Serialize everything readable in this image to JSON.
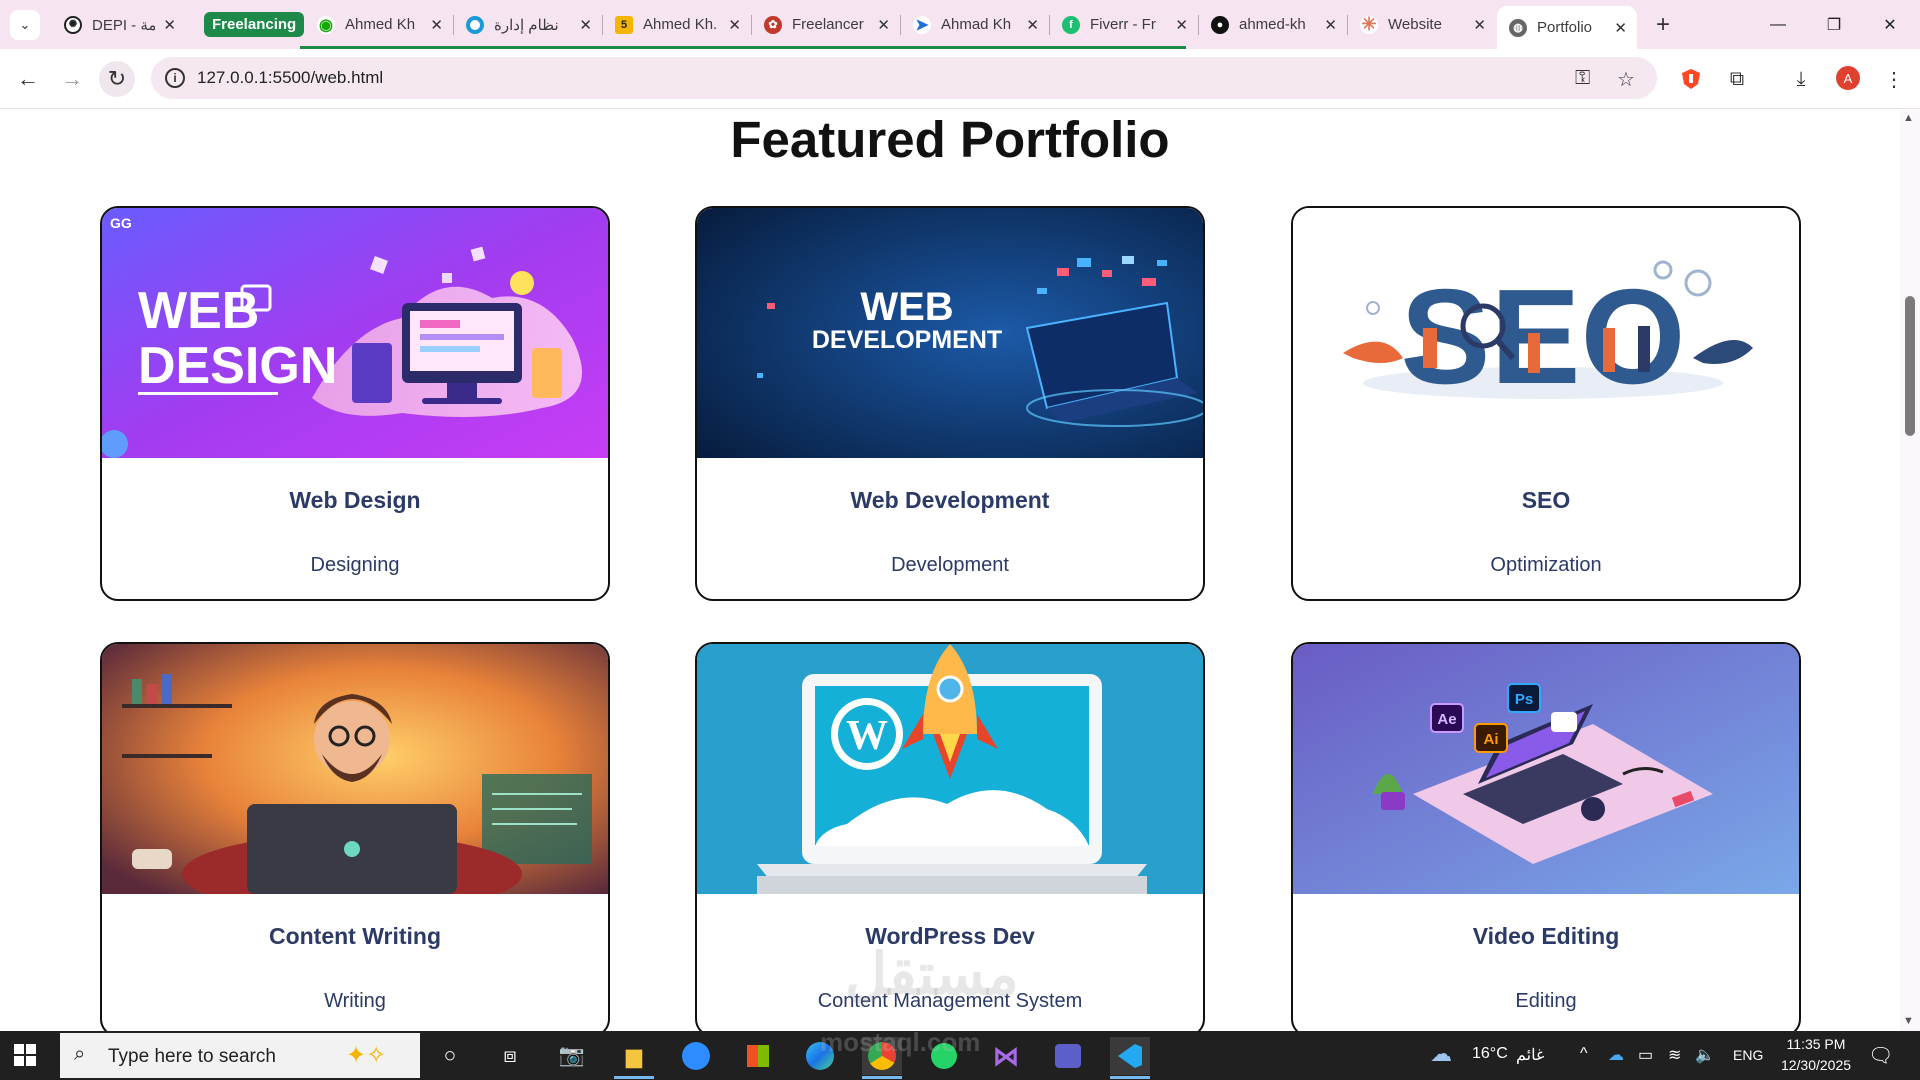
{
  "browser": {
    "tabs": [
      {
        "title": "DEPI - قائمة",
        "favicon": "chatgpt-icon",
        "color": "#202123"
      },
      {
        "title": "Ahmed Kh",
        "favicon": "upwork-icon",
        "color": "#14a800"
      },
      {
        "title": "نظام إدارة",
        "favicon": "circle-icon",
        "color": "#1a9bd7"
      },
      {
        "title": "Ahmed Kh.",
        "favicon": "five-icon",
        "color": "#f5b400"
      },
      {
        "title": "Freelancer",
        "favicon": "freelancer-icon",
        "color": "#c0392b"
      },
      {
        "title": "Ahmad Kh",
        "favicon": "bird-icon",
        "color": "#1f6fd6"
      },
      {
        "title": "Fiverr - Fr",
        "favicon": "fiverr-icon",
        "color": "#1dbf73"
      },
      {
        "title": "ahmed-kh",
        "favicon": "github-icon",
        "color": "#111111"
      },
      {
        "title": "Website",
        "favicon": "claude-icon",
        "color": "#d97757"
      },
      {
        "title": "Portfolio",
        "favicon": "globe-icon",
        "color": "#555555"
      }
    ],
    "tab_group_label": "Freelancing",
    "group_color": "#1e8a4a",
    "address": "127.0.0.1:5500/web.html",
    "profile_initial": "A",
    "profile_color": "#e0412f"
  },
  "page": {
    "title": "Featured Portfolio",
    "cards": [
      {
        "title": "Web Design",
        "subtitle": "Designing",
        "image": "web-design-illustration",
        "art_text_1": "WEB",
        "art_text_2": "DESIGN",
        "logo_text": "GG"
      },
      {
        "title": "Web Development",
        "subtitle": "Development",
        "image": "web-development-illustration",
        "art_text_1": "WEB",
        "art_text_2": "DEVELOPMENT"
      },
      {
        "title": "SEO",
        "subtitle": "Optimization",
        "image": "seo-illustration",
        "art_text_1": "SEO"
      },
      {
        "title": "Content Writing",
        "subtitle": "Writing",
        "image": "content-writer-illustration"
      },
      {
        "title": "WordPress Dev",
        "subtitle": "Content Management System",
        "image": "wordpress-rocket-illustration"
      },
      {
        "title": "Video Editing",
        "subtitle": "Editing",
        "image": "adobe-laptop-illustration",
        "badges": [
          "Ae",
          "Ps",
          "Ai"
        ]
      }
    ],
    "text_color": "#2b3a67"
  },
  "taskbar": {
    "search_placeholder": "Type here to search",
    "weather": "16°C",
    "weather_desc": "غائم",
    "language": "ENG",
    "time": "11:35 PM",
    "date": "12/30/2025"
  },
  "watermark": {
    "line1": "مستقل",
    "line2": "mostaql.com"
  }
}
